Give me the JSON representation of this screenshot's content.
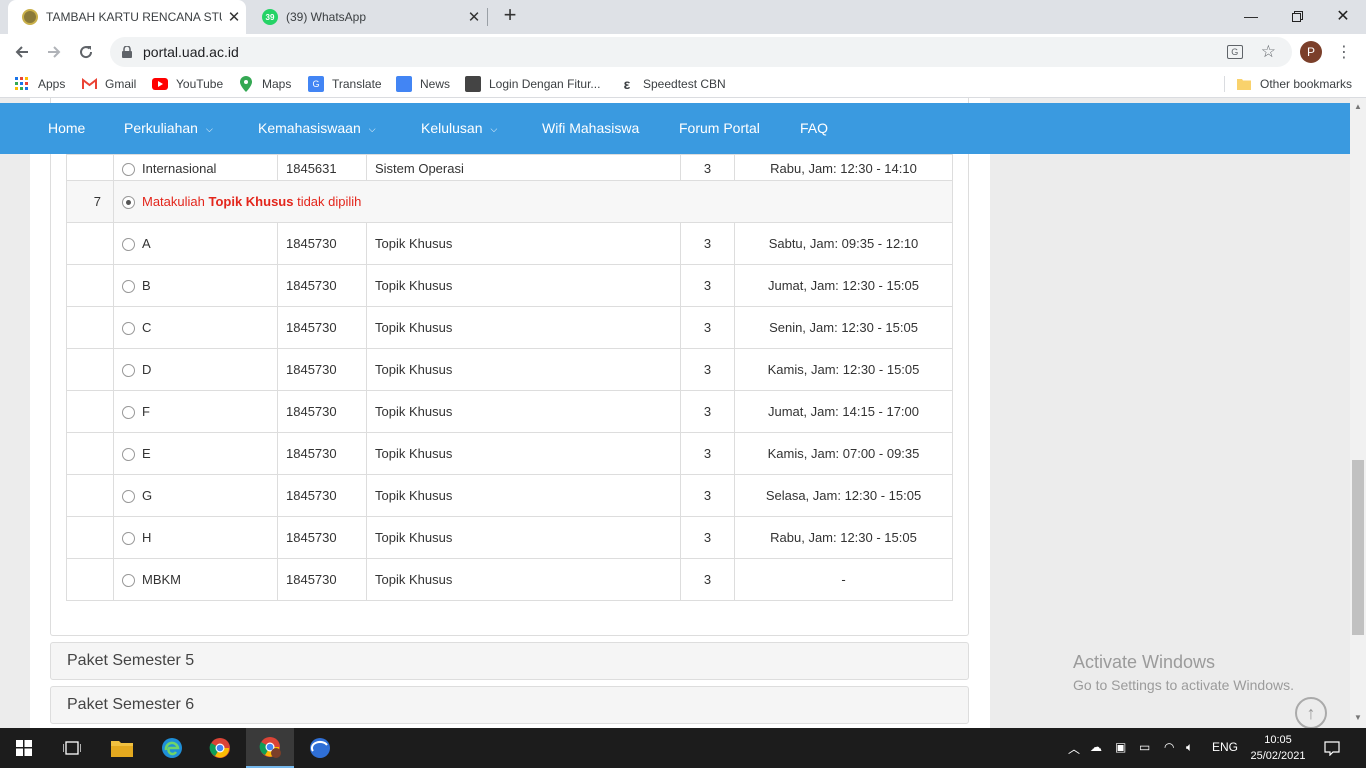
{
  "browser": {
    "tabs": [
      {
        "title": "TAMBAH KARTU RENCANA STUD",
        "active": true,
        "icon": "uad-logo-icon"
      },
      {
        "title": "(39) WhatsApp",
        "active": false,
        "icon": "whatsapp-icon",
        "badge": "39"
      }
    ],
    "url": "portal.uad.ac.id",
    "avatar_letter": "P",
    "bookmarks": [
      "Apps",
      "Gmail",
      "YouTube",
      "Maps",
      "Translate",
      "News",
      "Login Dengan Fitur...",
      "Speedtest CBN"
    ],
    "other_bookmarks": "Other bookmarks"
  },
  "navbar": {
    "items": [
      {
        "label": "Home",
        "dropdown": false
      },
      {
        "label": "Perkuliahan",
        "dropdown": true
      },
      {
        "label": "Kemahasiswaan",
        "dropdown": true
      },
      {
        "label": "Kelulusan",
        "dropdown": true
      },
      {
        "label": "Wifi Mahasiswa",
        "dropdown": false
      },
      {
        "label": "Forum Portal",
        "dropdown": false
      },
      {
        "label": "FAQ",
        "dropdown": false
      }
    ]
  },
  "table": {
    "prev_row": {
      "kelas": "Internasional",
      "kode": "1845631",
      "nama": "Sistem Operasi",
      "sks": "3",
      "jadwal": "Rabu, Jam: 12:30 - 14:10"
    },
    "group": {
      "no": "7",
      "text_prefix": "Matakuliah ",
      "course_bold": "Topik Khusus",
      "text_suffix": " tidak dipilih"
    },
    "rows": [
      {
        "kelas": "A",
        "kode": "1845730",
        "nama": "Topik Khusus",
        "sks": "3",
        "jadwal": "Sabtu, Jam: 09:35 - 12:10"
      },
      {
        "kelas": "B",
        "kode": "1845730",
        "nama": "Topik Khusus",
        "sks": "3",
        "jadwal": "Jumat, Jam: 12:30 - 15:05"
      },
      {
        "kelas": "C",
        "kode": "1845730",
        "nama": "Topik Khusus",
        "sks": "3",
        "jadwal": "Senin, Jam: 12:30 - 15:05"
      },
      {
        "kelas": "D",
        "kode": "1845730",
        "nama": "Topik Khusus",
        "sks": "3",
        "jadwal": "Kamis, Jam: 12:30 - 15:05"
      },
      {
        "kelas": "F",
        "kode": "1845730",
        "nama": "Topik Khusus",
        "sks": "3",
        "jadwal": "Jumat, Jam: 14:15 - 17:00"
      },
      {
        "kelas": "E",
        "kode": "1845730",
        "nama": "Topik Khusus",
        "sks": "3",
        "jadwal": "Kamis, Jam: 07:00 - 09:35"
      },
      {
        "kelas": "G",
        "kode": "1845730",
        "nama": "Topik Khusus",
        "sks": "3",
        "jadwal": "Selasa, Jam: 12:30 - 15:05"
      },
      {
        "kelas": "H",
        "kode": "1845730",
        "nama": "Topik Khusus",
        "sks": "3",
        "jadwal": "Rabu, Jam: 12:30 - 15:05"
      },
      {
        "kelas": "MBKM",
        "kode": "1845730",
        "nama": "Topik Khusus",
        "sks": "3",
        "jadwal": "-"
      }
    ]
  },
  "semesters": [
    "Paket Semester 5",
    "Paket Semester 6"
  ],
  "watermark": {
    "title": "Activate Windows",
    "subtitle": "Go to Settings to activate Windows."
  },
  "taskbar": {
    "lang": "ENG",
    "time": "10:05",
    "date": "25/02/2021"
  }
}
